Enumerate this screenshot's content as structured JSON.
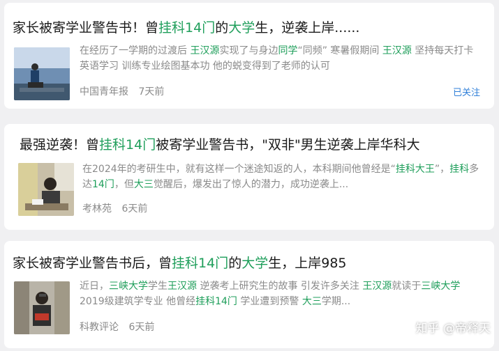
{
  "cards": [
    {
      "title": [
        {
          "t": "家长被寄学业警告书！曾",
          "hl": false
        },
        {
          "t": "挂科14门",
          "hl": true
        },
        {
          "t": "的",
          "hl": false
        },
        {
          "t": "大学",
          "hl": true
        },
        {
          "t": "生，逆袭上岸......",
          "hl": false
        }
      ],
      "snippet": [
        {
          "t": "在经历了一学期的过渡后 ",
          "hl": false
        },
        {
          "t": "王汉源",
          "hl": true
        },
        {
          "t": "实现了与身边",
          "hl": false
        },
        {
          "t": "同学",
          "hl": true
        },
        {
          "t": "“同频” 寒暑假期间 ",
          "hl": false
        },
        {
          "t": "王汉源",
          "hl": true
        },
        {
          "t": " 坚持每天打卡英语学习 训练专业绘图基本功 他的蜕变得到了老师的认可",
          "hl": false
        }
      ],
      "source": "中国青年报",
      "time": "7天前",
      "follow": "已关注"
    },
    {
      "title": [
        {
          "t": "最强逆袭！曾",
          "hl": false
        },
        {
          "t": "挂科14门",
          "hl": true
        },
        {
          "t": "被寄学业警告书，\"双非\"男生逆袭上岸华科大",
          "hl": false
        }
      ],
      "snippet": [
        {
          "t": "在2024年的考研生中，就有这样一个迷途知返的人，本科期间他曾经是“",
          "hl": false
        },
        {
          "t": "挂科大王",
          "hl": true
        },
        {
          "t": "”，",
          "hl": false
        },
        {
          "t": "挂科",
          "hl": true
        },
        {
          "t": "多达",
          "hl": false
        },
        {
          "t": "14门",
          "hl": true
        },
        {
          "t": "，但",
          "hl": false
        },
        {
          "t": "大三",
          "hl": true
        },
        {
          "t": "觉醒后，爆发出了惊人的潜力，成功逆袭上...",
          "hl": false
        }
      ],
      "source": "考林苑",
      "time": "6天前"
    },
    {
      "title": [
        {
          "t": "家长被寄学业警告书后，曾",
          "hl": false
        },
        {
          "t": "挂科14门",
          "hl": true
        },
        {
          "t": "的",
          "hl": false
        },
        {
          "t": "大学",
          "hl": true
        },
        {
          "t": "生，上岸985",
          "hl": false
        }
      ],
      "snippet": [
        {
          "t": "近日，",
          "hl": false
        },
        {
          "t": "三峡大学",
          "hl": true
        },
        {
          "t": "学生",
          "hl": false
        },
        {
          "t": "王汉源",
          "hl": true
        },
        {
          "t": " 逆袭考上研究生的故事 引发许多关注 ",
          "hl": false
        },
        {
          "t": "王汉源",
          "hl": true
        },
        {
          "t": "就读于",
          "hl": false
        },
        {
          "t": "三峡大学",
          "hl": true
        },
        {
          "t": " 2019级建筑学专业 他曾经",
          "hl": false
        },
        {
          "t": "挂科14门",
          "hl": true
        },
        {
          "t": " 学业遭到预警 ",
          "hl": false
        },
        {
          "t": "大三",
          "hl": true
        },
        {
          "t": "学期...",
          "hl": false
        }
      ],
      "source": "科教评论",
      "time": "6天前"
    }
  ],
  "watermark": "知乎 @帝释天",
  "colors": {
    "highlight": "#1e9e5a",
    "follow": "#2f7fd8",
    "muted": "#8a8a8a"
  }
}
